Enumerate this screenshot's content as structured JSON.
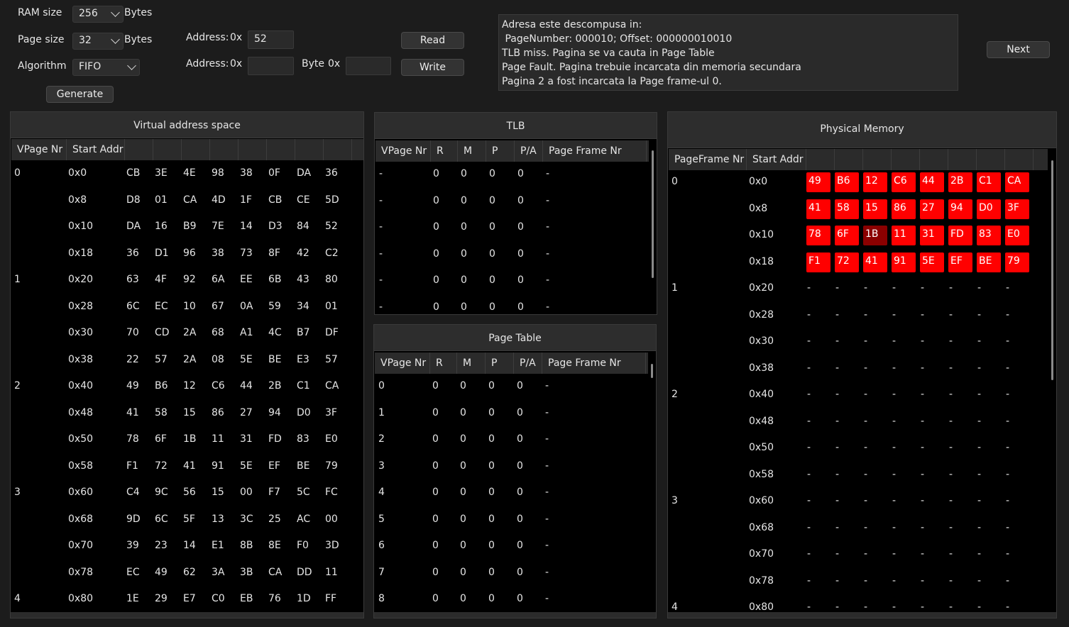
{
  "controls": {
    "ram_size_label": "RAM size",
    "ram_size_value": "256",
    "ram_size_unit": "Bytes",
    "page_size_label": "Page size",
    "page_size_value": "32",
    "page_size_unit": "Bytes",
    "algorithm_label": "Algorithm",
    "algorithm_value": "FIFO",
    "generate_label": "Generate",
    "read_address_label": "Address:",
    "read_address_prefix": "0x",
    "read_address_value": "52",
    "write_address_label": "Address:",
    "write_address_prefix": "0x",
    "write_address_value": "",
    "byte_label": "Byte",
    "byte_prefix": "0x",
    "byte_value": "",
    "read_label": "Read",
    "write_label": "Write",
    "next_label": "Next"
  },
  "log": {
    "lines": [
      "Adresa este descompusa in:",
      " PageNumber: 000010; Offset: 000000010010",
      "TLB miss. Pagina se va cauta in Page Table",
      "Page Fault. Pagina trebuie incarcata din memoria secundara",
      "Pagina 2 a fost incarcata la Page frame-ul 0."
    ]
  },
  "virtual": {
    "title": "Virtual address space",
    "headers": [
      "VPage Nr",
      "Start Addr",
      "",
      "",
      "",
      "",
      "",
      "",
      "",
      ""
    ],
    "rows": [
      {
        "page": "0",
        "addr": "0x0",
        "bytes": [
          "CB",
          "3E",
          "4E",
          "98",
          "38",
          "0F",
          "DA",
          "36"
        ]
      },
      {
        "page": "",
        "addr": "0x8",
        "bytes": [
          "D8",
          "01",
          "CA",
          "4D",
          "1F",
          "CB",
          "CE",
          "5D"
        ]
      },
      {
        "page": "",
        "addr": "0x10",
        "bytes": [
          "DA",
          "16",
          "B9",
          "7E",
          "14",
          "D3",
          "84",
          "52"
        ]
      },
      {
        "page": "",
        "addr": "0x18",
        "bytes": [
          "36",
          "D1",
          "96",
          "38",
          "73",
          "8F",
          "42",
          "C2"
        ]
      },
      {
        "page": "1",
        "addr": "0x20",
        "bytes": [
          "63",
          "4F",
          "92",
          "6A",
          "EE",
          "6B",
          "43",
          "80"
        ]
      },
      {
        "page": "",
        "addr": "0x28",
        "bytes": [
          "6C",
          "EC",
          "10",
          "67",
          "0A",
          "59",
          "34",
          "01"
        ]
      },
      {
        "page": "",
        "addr": "0x30",
        "bytes": [
          "70",
          "CD",
          "2A",
          "68",
          "A1",
          "4C",
          "B7",
          "DF"
        ]
      },
      {
        "page": "",
        "addr": "0x38",
        "bytes": [
          "22",
          "57",
          "2A",
          "08",
          "5E",
          "BE",
          "E3",
          "57"
        ]
      },
      {
        "page": "2",
        "addr": "0x40",
        "bytes": [
          "49",
          "B6",
          "12",
          "C6",
          "44",
          "2B",
          "C1",
          "CA"
        ]
      },
      {
        "page": "",
        "addr": "0x48",
        "bytes": [
          "41",
          "58",
          "15",
          "86",
          "27",
          "94",
          "D0",
          "3F"
        ]
      },
      {
        "page": "",
        "addr": "0x50",
        "bytes": [
          "78",
          "6F",
          "1B",
          "11",
          "31",
          "FD",
          "83",
          "E0"
        ]
      },
      {
        "page": "",
        "addr": "0x58",
        "bytes": [
          "F1",
          "72",
          "41",
          "91",
          "5E",
          "EF",
          "BE",
          "79"
        ]
      },
      {
        "page": "3",
        "addr": "0x60",
        "bytes": [
          "C4",
          "9C",
          "56",
          "15",
          "00",
          "F7",
          "5C",
          "FC"
        ]
      },
      {
        "page": "",
        "addr": "0x68",
        "bytes": [
          "9D",
          "6C",
          "5F",
          "13",
          "3C",
          "25",
          "AC",
          "00"
        ]
      },
      {
        "page": "",
        "addr": "0x70",
        "bytes": [
          "39",
          "23",
          "14",
          "E1",
          "8B",
          "8E",
          "F0",
          "3D"
        ]
      },
      {
        "page": "",
        "addr": "0x78",
        "bytes": [
          "EC",
          "49",
          "62",
          "3A",
          "3B",
          "CA",
          "DD",
          "11"
        ]
      },
      {
        "page": "4",
        "addr": "0x80",
        "bytes": [
          "1E",
          "29",
          "E7",
          "C0",
          "EB",
          "76",
          "1D",
          "FF"
        ]
      }
    ]
  },
  "tlb": {
    "title": "TLB",
    "headers": [
      "VPage Nr",
      "R",
      "M",
      "P",
      "P/A",
      "Page Frame Nr"
    ],
    "rows": [
      [
        "-",
        "0",
        "0",
        "0",
        "0",
        "-"
      ],
      [
        "-",
        "0",
        "0",
        "0",
        "0",
        "-"
      ],
      [
        "-",
        "0",
        "0",
        "0",
        "0",
        "-"
      ],
      [
        "-",
        "0",
        "0",
        "0",
        "0",
        "-"
      ],
      [
        "-",
        "0",
        "0",
        "0",
        "0",
        "-"
      ],
      [
        "-",
        "0",
        "0",
        "0",
        "0",
        "-"
      ]
    ]
  },
  "page_table": {
    "title": "Page Table",
    "headers": [
      "VPage Nr",
      "R",
      "M",
      "P",
      "P/A",
      "Page Frame Nr"
    ],
    "rows": [
      [
        "0",
        "0",
        "0",
        "0",
        "0",
        "-"
      ],
      [
        "1",
        "0",
        "0",
        "0",
        "0",
        "-"
      ],
      [
        "2",
        "0",
        "0",
        "0",
        "0",
        "-"
      ],
      [
        "3",
        "0",
        "0",
        "0",
        "0",
        "-"
      ],
      [
        "4",
        "0",
        "0",
        "0",
        "0",
        "-"
      ],
      [
        "5",
        "0",
        "0",
        "0",
        "0",
        "-"
      ],
      [
        "6",
        "0",
        "0",
        "0",
        "0",
        "-"
      ],
      [
        "7",
        "0",
        "0",
        "0",
        "0",
        "-"
      ],
      [
        "8",
        "0",
        "0",
        "0",
        "0",
        "-"
      ]
    ]
  },
  "physical": {
    "title": "Physical Memory",
    "headers": [
      "PageFrame Nr",
      "Start Addr",
      "",
      "",
      "",
      "",
      "",
      "",
      "",
      ""
    ],
    "highlight_color": "#ff0000",
    "accessed_color": "#8b0000",
    "rows": [
      {
        "frame": "0",
        "addr": "0x0",
        "bytes": [
          "49",
          "B6",
          "12",
          "C6",
          "44",
          "2B",
          "C1",
          "CA"
        ],
        "loaded": true
      },
      {
        "frame": "",
        "addr": "0x8",
        "bytes": [
          "41",
          "58",
          "15",
          "86",
          "27",
          "94",
          "D0",
          "3F"
        ],
        "loaded": true
      },
      {
        "frame": "",
        "addr": "0x10",
        "bytes": [
          "78",
          "6F",
          "1B",
          "11",
          "31",
          "FD",
          "83",
          "E0"
        ],
        "loaded": true,
        "accessed_index": 2
      },
      {
        "frame": "",
        "addr": "0x18",
        "bytes": [
          "F1",
          "72",
          "41",
          "91",
          "5E",
          "EF",
          "BE",
          "79"
        ],
        "loaded": true
      },
      {
        "frame": "1",
        "addr": "0x20",
        "bytes": [
          "-",
          "-",
          "-",
          "-",
          "-",
          "-",
          "-",
          "-"
        ]
      },
      {
        "frame": "",
        "addr": "0x28",
        "bytes": [
          "-",
          "-",
          "-",
          "-",
          "-",
          "-",
          "-",
          "-"
        ]
      },
      {
        "frame": "",
        "addr": "0x30",
        "bytes": [
          "-",
          "-",
          "-",
          "-",
          "-",
          "-",
          "-",
          "-"
        ]
      },
      {
        "frame": "",
        "addr": "0x38",
        "bytes": [
          "-",
          "-",
          "-",
          "-",
          "-",
          "-",
          "-",
          "-"
        ]
      },
      {
        "frame": "2",
        "addr": "0x40",
        "bytes": [
          "-",
          "-",
          "-",
          "-",
          "-",
          "-",
          "-",
          "-"
        ]
      },
      {
        "frame": "",
        "addr": "0x48",
        "bytes": [
          "-",
          "-",
          "-",
          "-",
          "-",
          "-",
          "-",
          "-"
        ]
      },
      {
        "frame": "",
        "addr": "0x50",
        "bytes": [
          "-",
          "-",
          "-",
          "-",
          "-",
          "-",
          "-",
          "-"
        ]
      },
      {
        "frame": "",
        "addr": "0x58",
        "bytes": [
          "-",
          "-",
          "-",
          "-",
          "-",
          "-",
          "-",
          "-"
        ]
      },
      {
        "frame": "3",
        "addr": "0x60",
        "bytes": [
          "-",
          "-",
          "-",
          "-",
          "-",
          "-",
          "-",
          "-"
        ]
      },
      {
        "frame": "",
        "addr": "0x68",
        "bytes": [
          "-",
          "-",
          "-",
          "-",
          "-",
          "-",
          "-",
          "-"
        ]
      },
      {
        "frame": "",
        "addr": "0x70",
        "bytes": [
          "-",
          "-",
          "-",
          "-",
          "-",
          "-",
          "-",
          "-"
        ]
      },
      {
        "frame": "",
        "addr": "0x78",
        "bytes": [
          "-",
          "-",
          "-",
          "-",
          "-",
          "-",
          "-",
          "-"
        ]
      },
      {
        "frame": "4",
        "addr": "0x80",
        "bytes": [
          "-",
          "-",
          "-",
          "-",
          "-",
          "-",
          "-",
          "-"
        ]
      }
    ]
  }
}
